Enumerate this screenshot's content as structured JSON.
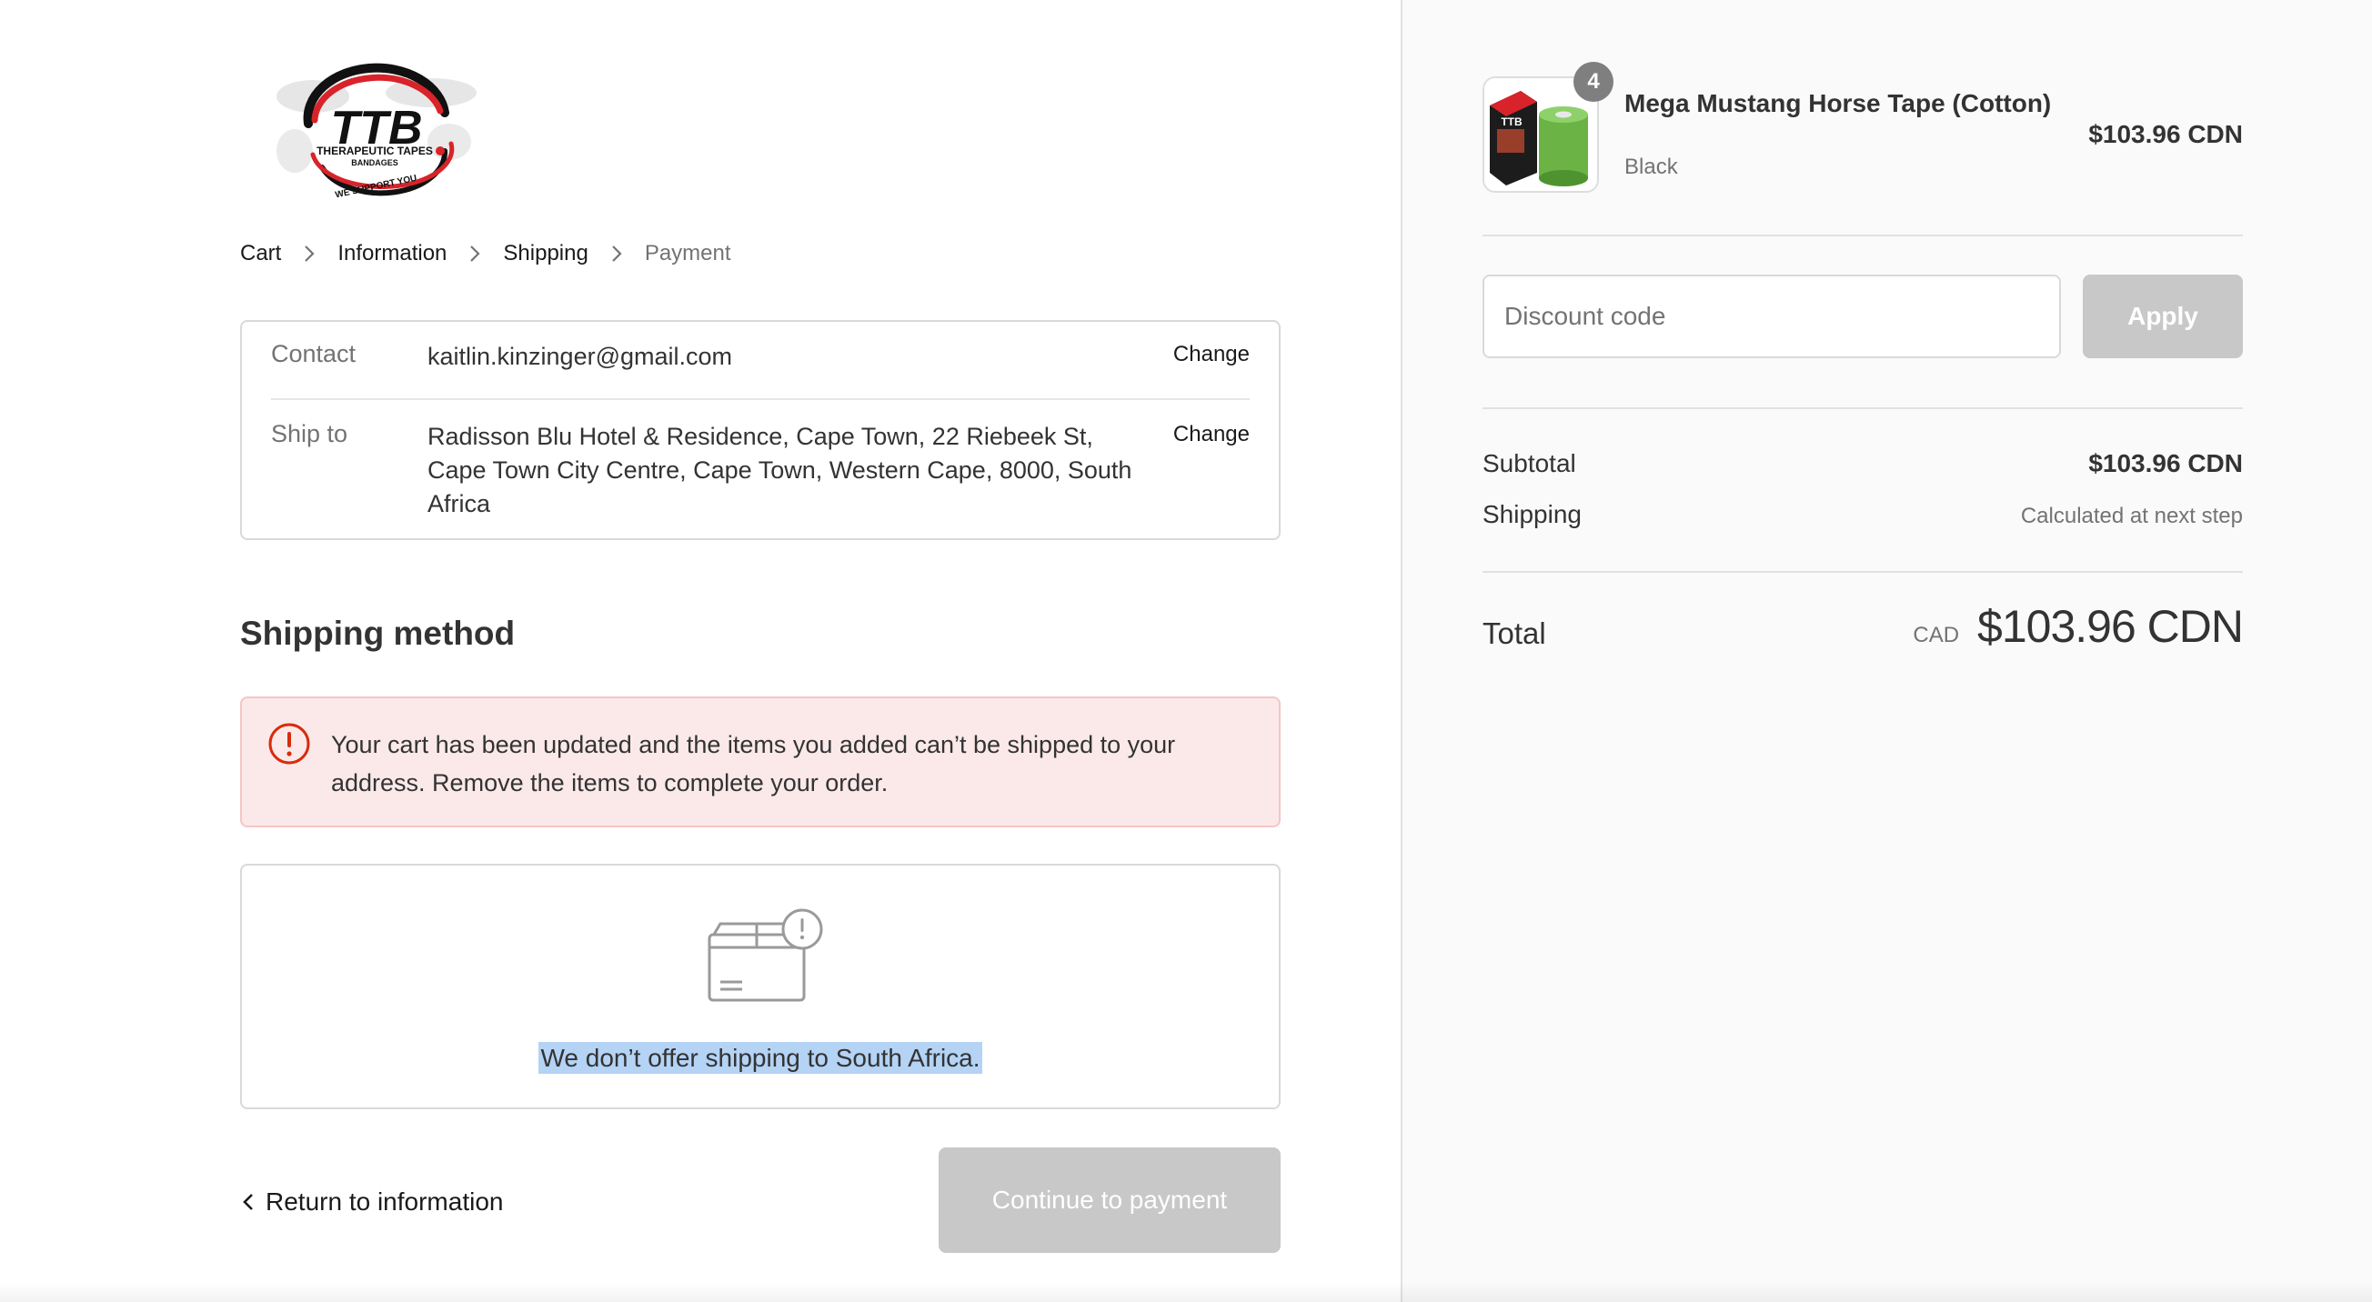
{
  "logo": {
    "letters": "TTB",
    "line1": "THERAPEUTIC TAPES",
    "line2": "BANDAGES",
    "tagline": "WE SUPPORT YOU",
    "colors": {
      "red": "#d8232a",
      "black": "#111111"
    }
  },
  "breadcrumb": {
    "items": [
      "Cart",
      "Information",
      "Shipping",
      "Payment"
    ]
  },
  "review": {
    "contact_label": "Contact",
    "contact_value": "kaitlin.kinzinger@gmail.com",
    "ship_label": "Ship to",
    "ship_value": "Radisson Blu Hotel & Residence, Cape Town, 22 Riebeek St, Cape Town City Centre, Cape Town, Western Cape, 8000, South Africa",
    "change_label": "Change"
  },
  "shipping_method": {
    "title": "Shipping method",
    "error_message": "Your cart has been updated and the items you added can’t be shipped to your address. Remove the items to complete your order.",
    "empty_message": "We don’t offer shipping to South Africa."
  },
  "actions": {
    "return_label": "Return to information",
    "continue_label": "Continue to payment"
  },
  "summary": {
    "product": {
      "name": "Mega Mustang Horse Tape (Cotton)",
      "variant": "Black",
      "price": "$103.96 CDN",
      "quantity": "4",
      "thumb_label": "TTB"
    },
    "discount": {
      "placeholder": "Discount code",
      "apply_label": "Apply"
    },
    "subtotal_label": "Subtotal",
    "subtotal_value": "$103.96 CDN",
    "shipping_label": "Shipping",
    "shipping_value": "Calculated at next step",
    "total_label": "Total",
    "total_currency": "CAD",
    "total_value": "$103.96 CDN"
  },
  "colors": {
    "error_bg": "#fbe9e9",
    "error_border": "#f5c6c6",
    "error_icon": "#d72c0d",
    "disabled_button": "#c8c8c8",
    "selection_highlight": "#b4d3f5",
    "sidebar_bg": "#fafafa"
  }
}
